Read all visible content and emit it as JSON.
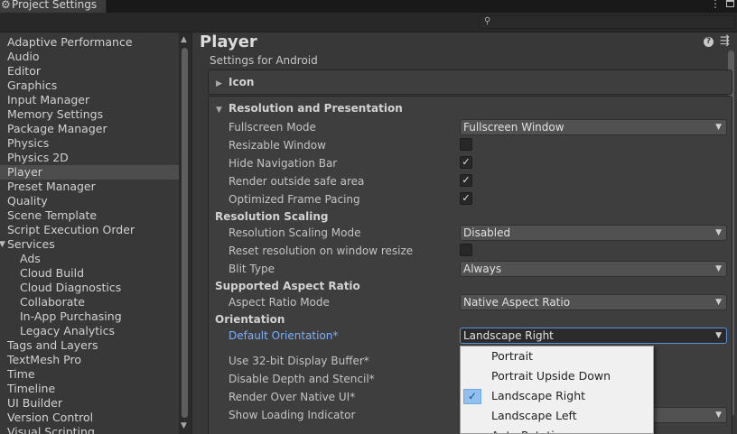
{
  "window": {
    "tab_title": "Project Settings",
    "gear_glyph": "⚙",
    "menu_glyph": "⋮",
    "search_glyph": "⚲"
  },
  "sidebar": {
    "items": [
      {
        "label": "Adaptive Performance",
        "level": 0,
        "selected": false
      },
      {
        "label": "Audio",
        "level": 0,
        "selected": false
      },
      {
        "label": "Editor",
        "level": 0,
        "selected": false
      },
      {
        "label": "Graphics",
        "level": 0,
        "selected": false
      },
      {
        "label": "Input Manager",
        "level": 0,
        "selected": false
      },
      {
        "label": "Memory Settings",
        "level": 0,
        "selected": false
      },
      {
        "label": "Package Manager",
        "level": 0,
        "selected": false
      },
      {
        "label": "Physics",
        "level": 0,
        "selected": false
      },
      {
        "label": "Physics 2D",
        "level": 0,
        "selected": false
      },
      {
        "label": "Player",
        "level": 0,
        "selected": true
      },
      {
        "label": "Preset Manager",
        "level": 0,
        "selected": false
      },
      {
        "label": "Quality",
        "level": 0,
        "selected": false
      },
      {
        "label": "Scene Template",
        "level": 0,
        "selected": false
      },
      {
        "label": "Script Execution Order",
        "level": 0,
        "selected": false
      },
      {
        "label": "Services",
        "level": 0,
        "selected": false,
        "expanded": true
      },
      {
        "label": "Ads",
        "level": 1,
        "selected": false
      },
      {
        "label": "Cloud Build",
        "level": 1,
        "selected": false
      },
      {
        "label": "Cloud Diagnostics",
        "level": 1,
        "selected": false
      },
      {
        "label": "Collaborate",
        "level": 1,
        "selected": false
      },
      {
        "label": "In-App Purchasing",
        "level": 1,
        "selected": false
      },
      {
        "label": "Legacy Analytics",
        "level": 1,
        "selected": false
      },
      {
        "label": "Tags and Layers",
        "level": 0,
        "selected": false
      },
      {
        "label": "TextMesh Pro",
        "level": 0,
        "selected": false
      },
      {
        "label": "Time",
        "level": 0,
        "selected": false
      },
      {
        "label": "Timeline",
        "level": 0,
        "selected": false
      },
      {
        "label": "UI Builder",
        "level": 0,
        "selected": false
      },
      {
        "label": "Version Control",
        "level": 0,
        "selected": false
      },
      {
        "label": "Visual Scripting",
        "level": 0,
        "selected": false
      }
    ]
  },
  "main": {
    "title": "Player",
    "help_glyph": "?",
    "preset_glyph": "⇶",
    "subtitle": "Settings for Android",
    "icon_section": "Icon",
    "resolution_section": "Resolution and Presentation",
    "fullscreen_mode": {
      "label": "Fullscreen Mode",
      "value": "Fullscreen Window"
    },
    "resizable_window": {
      "label": "Resizable Window",
      "checked": false
    },
    "hide_navigation_bar": {
      "label": "Hide Navigation Bar",
      "checked": true
    },
    "render_outside_safe_area": {
      "label": "Render outside safe area",
      "checked": true
    },
    "optimized_frame_pacing": {
      "label": "Optimized Frame Pacing",
      "checked": true
    },
    "resolution_scaling": "Resolution Scaling",
    "resolution_scaling_mode": {
      "label": "Resolution Scaling Mode",
      "value": "Disabled"
    },
    "reset_resolution": {
      "label": "Reset resolution on window resize",
      "checked": false
    },
    "blit_type": {
      "label": "Blit Type",
      "value": "Always"
    },
    "supported_aspect_ratio": "Supported Aspect Ratio",
    "aspect_ratio_mode": {
      "label": "Aspect Ratio Mode",
      "value": "Native Aspect Ratio"
    },
    "orientation": "Orientation",
    "default_orientation": {
      "label": "Default Orientation*",
      "value": "Landscape Right"
    },
    "use_32bit_display_buffer": {
      "label": "Use 32-bit Display Buffer*"
    },
    "disable_depth_and_stencil": {
      "label": "Disable Depth and Stencil*"
    },
    "render_over_native_ui": {
      "label": "Render Over Native UI*"
    },
    "show_loading_indicator": {
      "label": "Show Loading Indicator"
    }
  },
  "orientation_menu": {
    "options": [
      "Portrait",
      "Portrait Upside Down",
      "Landscape Right",
      "Landscape Left",
      "Auto Rotation"
    ],
    "selected": "Landscape Right",
    "check_glyph": "✓"
  },
  "glyphs": {
    "check": "✓",
    "caret": "▼",
    "fold_closed": "▶",
    "fold_open": "▼",
    "scroll_up": "▲",
    "scroll_down": "▼"
  }
}
